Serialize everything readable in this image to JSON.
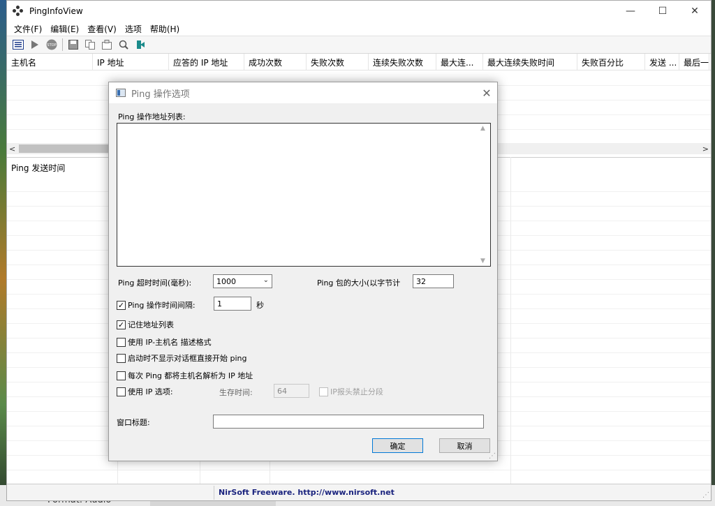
{
  "window": {
    "title": "PingInfoView",
    "controls": {
      "minimize": "—",
      "maximize": "☐",
      "close": "✕"
    }
  },
  "menu": [
    "文件(F)",
    "编辑(E)",
    "查看(V)",
    "选项",
    "帮助(H)"
  ],
  "toolbar_icons": [
    "list-icon",
    "play-icon",
    "stop-icon",
    "save-icon",
    "copy-icon",
    "properties-icon",
    "find-icon",
    "exit-icon"
  ],
  "columns": [
    "主机名",
    "IP 地址",
    "应答的 IP 地址",
    "成功次数",
    "失败次数",
    "连续失败次数",
    "最大连...",
    "最大连续失败时间",
    "失败百分比",
    "发送 ...",
    "最后一次"
  ],
  "lower_pane": {
    "header": "Ping 发送时间"
  },
  "status": {
    "text": "NirSoft Freeware.  http://www.nirsoft.net"
  },
  "desktop": {
    "peek_text": "Format: Audio"
  },
  "dialog": {
    "title": "Ping 操作选项",
    "address_list_label": "Ping 操作地址列表:",
    "address_list_value": "",
    "timeout_label": "Ping 超时时间(毫秒):",
    "timeout_value": "1000",
    "packet_size_label": "Ping 包的大小(以字节计",
    "packet_size_value": "32",
    "interval_label": "Ping 操作时间间隔:",
    "interval_value": "1",
    "interval_unit": "秒",
    "remember_list_label": "记住地址列表",
    "ip_host_format_label": "使用 IP-主机名 描述格式",
    "start_without_dialog_label": "启动时不显示对话框直接开始 ping",
    "resolve_each_label": "每次 Ping 都将主机名解析为 IP 地址",
    "use_ip_options_label": "使用 IP 选项:",
    "ttl_label": "生存时间:",
    "ttl_value": "64",
    "dont_fragment_label": "IP报头禁止分段",
    "window_title_label": "窗口标题:",
    "window_title_value": "",
    "ok_label": "确定",
    "cancel_label": "取消",
    "checked": {
      "interval": true,
      "remember_list": true,
      "ip_host_format": false,
      "start_without_dialog": false,
      "resolve_each": false,
      "use_ip_options": false,
      "dont_fragment": false
    }
  }
}
